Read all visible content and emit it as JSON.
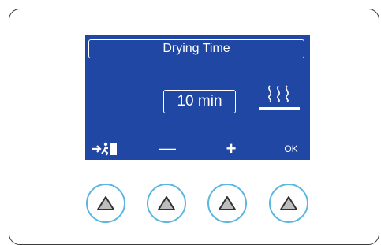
{
  "display": {
    "title": "Drying Time",
    "value": "10 min",
    "mode_icon": "steam-heat-icon"
  },
  "softkeys": {
    "exit_icon": "exit-icon",
    "minus": "—",
    "plus": "+",
    "ok": "OK"
  },
  "buttons": [
    {
      "icon": "triangle-up-icon"
    },
    {
      "icon": "triangle-up-icon"
    },
    {
      "icon": "triangle-up-icon"
    },
    {
      "icon": "triangle-up-icon"
    }
  ],
  "colors": {
    "screen_background": "#2147a4",
    "screen_text": "#ffffff",
    "button_ring": "#5bb6e0"
  }
}
